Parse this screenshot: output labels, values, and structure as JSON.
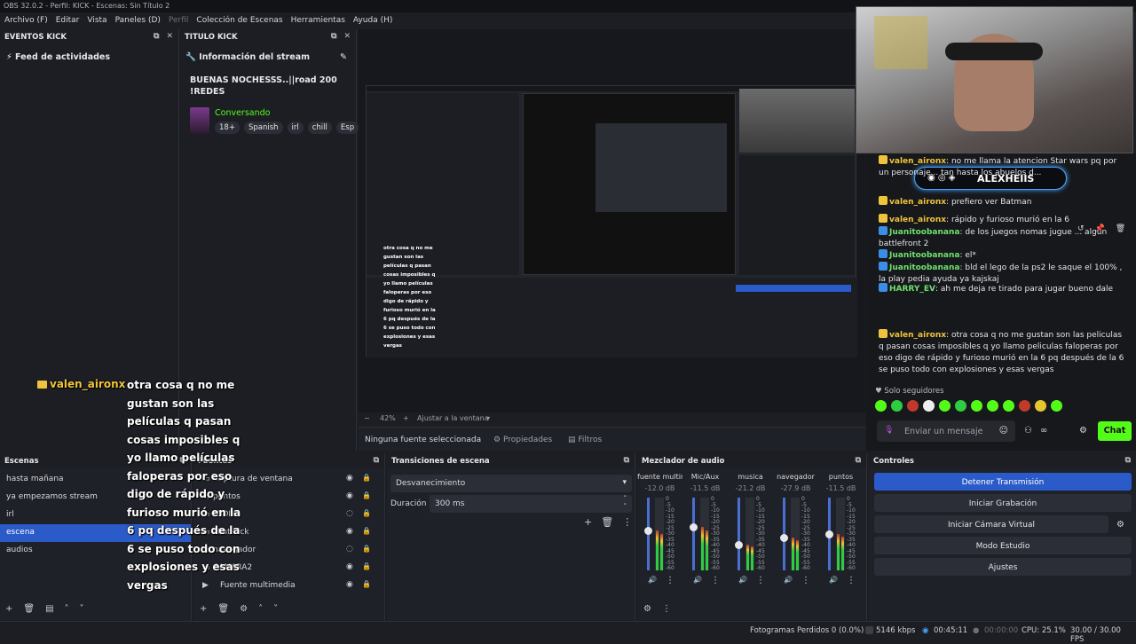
{
  "titlebar": {
    "text": "OBS 32.0.2 - Perfil: KICK - Escenas: Sin Título 2"
  },
  "menu": [
    {
      "label": "Archivo (F)",
      "dim": false
    },
    {
      "label": "Editar",
      "dim": false
    },
    {
      "label": "Vista",
      "dim": false
    },
    {
      "label": "Paneles (D)",
      "dim": false
    },
    {
      "label": "Perfil",
      "dim": true
    },
    {
      "label": "Colección de Escenas",
      "dim": false
    },
    {
      "label": "Herramientas",
      "dim": false
    },
    {
      "label": "Ayuda (H)",
      "dim": false
    }
  ],
  "eventos_dock": {
    "title": "EVENTOS KICK",
    "feed_label": "Feed de actividades"
  },
  "titulo_dock": {
    "title": "TITULO KICK",
    "info_label": "Información del stream",
    "stream_title": "BUENAS NOCHESSS..||road 200 !REDES",
    "category": "Conversando",
    "tags": [
      "18+",
      "Spanish",
      "irl",
      "chill",
      "Esp"
    ]
  },
  "preview": {
    "zoom": "42%",
    "adjust": "Ajustar a la ventana",
    "no_source": "Ninguna fuente seleccionada",
    "properties": "Propiedades",
    "filters": "Filtros"
  },
  "overlay_chat": {
    "user": "valen_aironx",
    "lines": [
      "otra cosa q no me",
      "gustan son las",
      "películas q pasan",
      "cosas imposibles q",
      "yo llamo películas",
      "faloperas por eso",
      "digo de rápido y",
      "furioso murió en la",
      "6 pq después de la",
      "6 se puso todo con",
      "explosiones y esas",
      "vergas"
    ]
  },
  "scenes": {
    "title": "Escenas",
    "items": [
      "hasta mañana",
      "ya empezamos stream",
      "irl",
      "escena",
      "audios"
    ],
    "selected": 3
  },
  "sources": {
    "title": "Fuentes",
    "items": [
      "Captura de ventana",
      "puntos",
      "(GDI+)",
      "chat kick",
      "navegador",
      "CAMARA2",
      "Fuente multimedia"
    ]
  },
  "transitions": {
    "title": "Transiciones de escena",
    "type": "Desvanecimiento",
    "duration_label": "Duración",
    "duration": "300 ms"
  },
  "mixer": {
    "title": "Mezclador de audio",
    "channels": [
      {
        "name": "fuente multimedia",
        "db": "-12.0 dB",
        "level": 0.55
      },
      {
        "name": "Mic/Aux",
        "db": "-11.5 dB",
        "level": 0.6
      },
      {
        "name": "musica",
        "db": "-21.2 dB",
        "level": 0.35
      },
      {
        "name": "navegador",
        "db": "-27.9 dB",
        "level": 0.45
      },
      {
        "name": "puntos",
        "db": "-11.5 dB",
        "level": 0.5
      }
    ],
    "scale": [
      "0",
      "-5",
      "-10",
      "-15",
      "-20",
      "-25",
      "-30",
      "-35",
      "-40",
      "-45",
      "-50",
      "-55",
      "-60"
    ]
  },
  "controls": {
    "title": "Controles",
    "buttons": [
      "Detener Transmisión",
      "Iniciar Grabación",
      "Iniciar Cámara Virtual",
      "Modo Estudio",
      "Ajustes"
    ]
  },
  "chat": {
    "overlay_name": "ALEXHEIIS",
    "messages": [
      {
        "user": "valen_aironx",
        "text": "no me llama la atencion Star wars pq por un personaje... tan hasta los abuelos d...",
        "style": "gold"
      },
      {
        "user": "valen_aironx",
        "text": "prefiero ver Batman",
        "style": "gold"
      },
      {
        "user": "valen_aironx",
        "text": "rápido y furioso murió en la 6",
        "style": "gold"
      },
      {
        "user": "Juanitoobanana",
        "text": "de los juegos nomas jugue ... algun battlefront 2",
        "style": "green"
      },
      {
        "user": "Juanitoobanana",
        "text": "el*",
        "style": "green"
      },
      {
        "user": "Juanitoobanana",
        "text": "bld el lego de la ps2 le saque el 100% , la play pedia ayuda ya kajskaj",
        "style": "green"
      },
      {
        "user": "HARRY_EV",
        "text": "ah me deja re tirado para jugar bueno dale",
        "style": "green"
      },
      {
        "user": "valen_aironx",
        "text": "otra cosa q no me gustan son las peliculas q pasan cosas imposibles q yo llamo peliculas faloperas por eso digo de rápido y furioso murió en la 6 pq después de la 6 se puso todo con explosiones y esas vergas",
        "style": "gold"
      }
    ],
    "followers_label": "Solo seguidores",
    "input_placeholder": "Enviar un mensaje",
    "send_label": "Chat"
  },
  "status": {
    "dropped": "Fotogramas Perdidos 0 (0.0%)",
    "bitrate": "5146 kbps",
    "stream_time": "00:45:11",
    "rec_time": "00:00:00",
    "cpu": "CPU: 25.1%",
    "fps": "30.00 / 30.00 FPS"
  },
  "colors": {
    "accent": "#2b5ac9",
    "live_green": "#53fc18",
    "name_gold": "#f0c43a"
  }
}
